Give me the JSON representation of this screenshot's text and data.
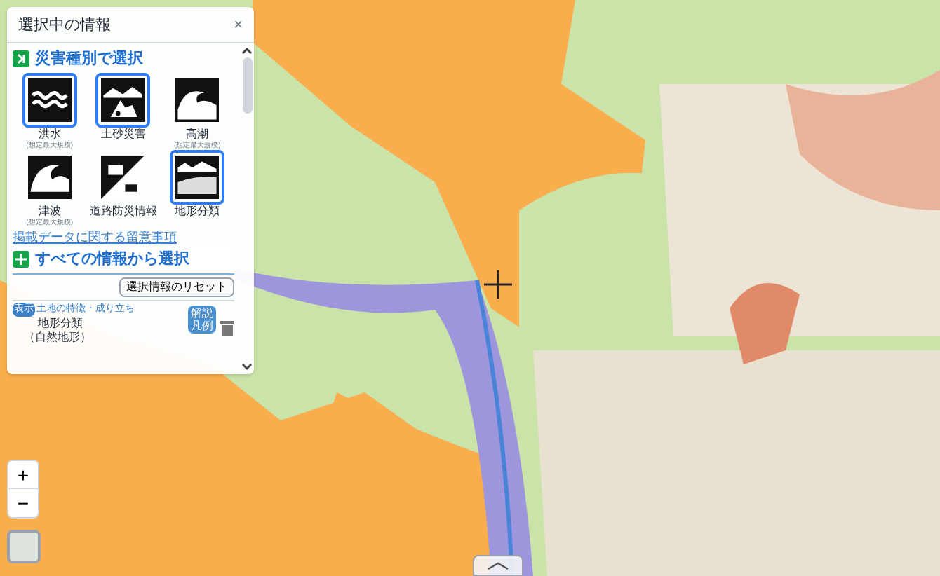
{
  "panel": {
    "title": "選択中の情報",
    "close": "×",
    "hazard_section": {
      "title": "災害種別で選択"
    },
    "hazards": [
      {
        "kind": "flood",
        "label": "洪水",
        "note": "(想定最大規模)",
        "selected": true
      },
      {
        "kind": "landslide",
        "label": "土砂災害",
        "selected": true
      },
      {
        "kind": "storm_surge",
        "label": "高潮",
        "note": "(想定最大規模)",
        "selected": false
      },
      {
        "kind": "tsunami",
        "label": "津波",
        "note": "(想定最大規模)",
        "selected": false
      },
      {
        "kind": "road",
        "label": "道路防災情報",
        "selected": false
      },
      {
        "kind": "terrain",
        "label": "地形分類",
        "selected": true
      }
    ],
    "notice_link": "掲載データに関する留意事項",
    "all_section": {
      "title": "すべての情報から選択"
    },
    "reset_button": "選択情報のリセット",
    "layer": {
      "badge": "表示",
      "category": "土地の特徴・成り立ち",
      "name": "地形分類",
      "sub": "（自然地形）",
      "legend_button": [
        "解説",
        "凡例"
      ]
    }
  },
  "zoom": {
    "in": "+",
    "out": "−"
  }
}
